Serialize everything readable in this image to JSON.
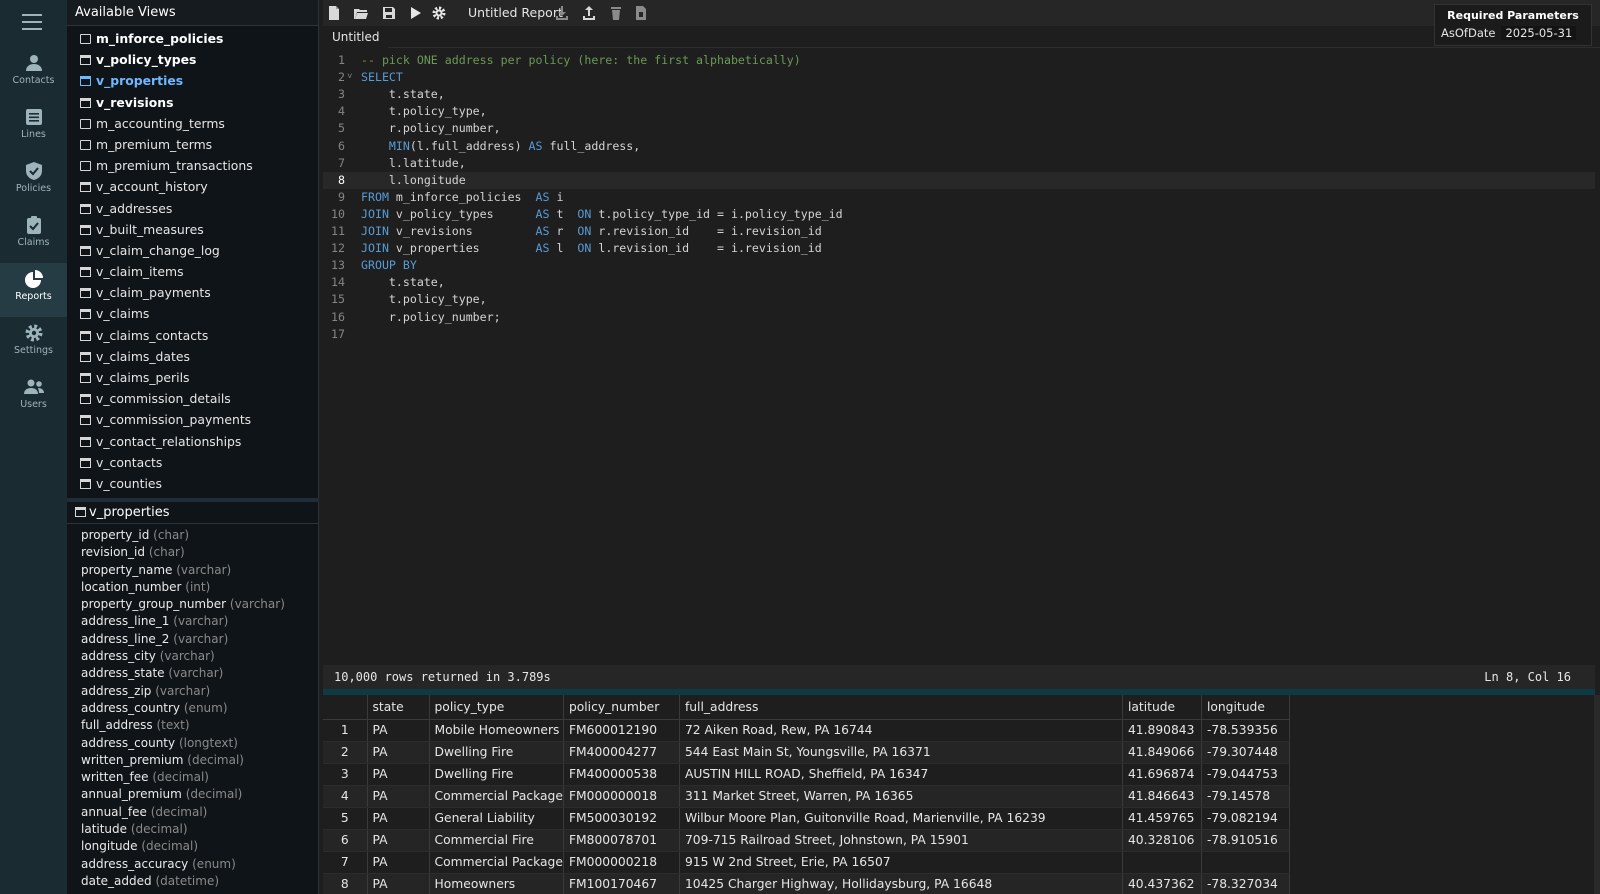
{
  "nav": {
    "items": [
      {
        "label": "Contacts",
        "icon": "person-icon"
      },
      {
        "label": "Lines",
        "icon": "list-icon"
      },
      {
        "label": "Policies",
        "icon": "shield-check-icon"
      },
      {
        "label": "Claims",
        "icon": "clipboard-check-icon"
      },
      {
        "label": "Reports",
        "icon": "pie-chart-icon",
        "active": true
      },
      {
        "label": "Settings",
        "icon": "gear-icon"
      },
      {
        "label": "Users",
        "icon": "users-icon"
      }
    ]
  },
  "views": {
    "title": "Available Views",
    "items": [
      {
        "label": "m_inforce_policies",
        "bold": true,
        "icon": "doc"
      },
      {
        "label": "v_policy_types",
        "bold": true,
        "icon": "table"
      },
      {
        "label": "v_properties",
        "bold": true,
        "selected": true,
        "icon": "table"
      },
      {
        "label": "v_revisions",
        "bold": true,
        "icon": "table"
      },
      {
        "label": "m_accounting_terms",
        "icon": "doc"
      },
      {
        "label": "m_premium_terms",
        "icon": "doc"
      },
      {
        "label": "m_premium_transactions",
        "icon": "doc"
      },
      {
        "label": "v_account_history",
        "icon": "table"
      },
      {
        "label": "v_addresses",
        "icon": "table"
      },
      {
        "label": "v_built_measures",
        "icon": "table"
      },
      {
        "label": "v_claim_change_log",
        "icon": "table"
      },
      {
        "label": "v_claim_items",
        "icon": "table"
      },
      {
        "label": "v_claim_payments",
        "icon": "table"
      },
      {
        "label": "v_claims",
        "icon": "table"
      },
      {
        "label": "v_claims_contacts",
        "icon": "table"
      },
      {
        "label": "v_claims_dates",
        "icon": "table"
      },
      {
        "label": "v_claims_perils",
        "icon": "table"
      },
      {
        "label": "v_commission_details",
        "icon": "table"
      },
      {
        "label": "v_commission_payments",
        "icon": "table"
      },
      {
        "label": "v_contact_relationships",
        "icon": "table"
      },
      {
        "label": "v_contacts",
        "icon": "table"
      },
      {
        "label": "v_counties",
        "icon": "table"
      }
    ]
  },
  "schema": {
    "title": "v_properties",
    "columns": [
      {
        "name": "property_id",
        "type": "(char)"
      },
      {
        "name": "revision_id",
        "type": "(char)"
      },
      {
        "name": "property_name",
        "type": "(varchar)"
      },
      {
        "name": "location_number",
        "type": "(int)"
      },
      {
        "name": "property_group_number",
        "type": "(varchar)"
      },
      {
        "name": "address_line_1",
        "type": "(varchar)"
      },
      {
        "name": "address_line_2",
        "type": "(varchar)"
      },
      {
        "name": "address_city",
        "type": "(varchar)"
      },
      {
        "name": "address_state",
        "type": "(varchar)"
      },
      {
        "name": "address_zip",
        "type": "(varchar)"
      },
      {
        "name": "address_country",
        "type": "(enum)"
      },
      {
        "name": "full_address",
        "type": "(text)"
      },
      {
        "name": "address_county",
        "type": "(longtext)"
      },
      {
        "name": "written_premium",
        "type": "(decimal)"
      },
      {
        "name": "written_fee",
        "type": "(decimal)"
      },
      {
        "name": "annual_premium",
        "type": "(decimal)"
      },
      {
        "name": "annual_fee",
        "type": "(decimal)"
      },
      {
        "name": "latitude",
        "type": "(decimal)"
      },
      {
        "name": "longitude",
        "type": "(decimal)"
      },
      {
        "name": "address_accuracy",
        "type": "(enum)"
      },
      {
        "name": "date_added",
        "type": "(datetime)"
      }
    ]
  },
  "toolbar": {
    "title": "Untitled Report"
  },
  "tab": {
    "label": "Untitled"
  },
  "params": {
    "heading": "Required Parameters",
    "name": "AsOfDate",
    "value": "2025-05-31"
  },
  "editor": {
    "current_line": 8,
    "lines": [
      [
        [
          "cm",
          "-- pick ONE address per policy (here: the first alphabetically)"
        ]
      ],
      [
        [
          "kw",
          "SELECT"
        ]
      ],
      [
        [
          "",
          "    t.state,"
        ]
      ],
      [
        [
          "",
          "    t.policy_type,"
        ]
      ],
      [
        [
          "",
          "    r.policy_number,"
        ]
      ],
      [
        [
          "",
          "    "
        ],
        [
          "kw",
          "MIN"
        ],
        [
          "",
          "(l.full_address) "
        ],
        [
          "kw",
          "AS"
        ],
        [
          "",
          " full_address,"
        ]
      ],
      [
        [
          "",
          "    l.latitude,"
        ]
      ],
      [
        [
          "",
          "    l.longitude"
        ]
      ],
      [
        [
          "kw",
          "FROM"
        ],
        [
          "",
          " m_inforce_policies  "
        ],
        [
          "kw",
          "AS"
        ],
        [
          "",
          " i"
        ]
      ],
      [
        [
          "kw",
          "JOIN"
        ],
        [
          "",
          " v_policy_types      "
        ],
        [
          "kw",
          "AS"
        ],
        [
          "",
          " t  "
        ],
        [
          "kw",
          "ON"
        ],
        [
          "",
          " t.policy_type_id = i.policy_type_id"
        ]
      ],
      [
        [
          "kw",
          "JOIN"
        ],
        [
          "",
          " v_revisions         "
        ],
        [
          "kw",
          "AS"
        ],
        [
          "",
          " r  "
        ],
        [
          "kw",
          "ON"
        ],
        [
          "",
          " r.revision_id    = i.revision_id"
        ]
      ],
      [
        [
          "kw",
          "JOIN"
        ],
        [
          "",
          " v_properties        "
        ],
        [
          "kw",
          "AS"
        ],
        [
          "",
          " l  "
        ],
        [
          "kw",
          "ON"
        ],
        [
          "",
          " l.revision_id    = i.revision_id"
        ]
      ],
      [
        [
          "kw",
          "GROUP BY"
        ]
      ],
      [
        [
          "",
          "    t.state,"
        ]
      ],
      [
        [
          "",
          "    t.policy_type,"
        ]
      ],
      [
        [
          "",
          "    r.policy_number;"
        ]
      ],
      [
        [
          "",
          ""
        ]
      ]
    ]
  },
  "status": {
    "rows_text": "10,000 rows returned in 3.789s",
    "cursor_text": "Ln 8, Col 16"
  },
  "results": {
    "headers": [
      "",
      "state",
      "policy_type",
      "policy_number",
      "full_address",
      "latitude",
      "longitude"
    ],
    "rows": [
      [
        "1",
        "PA",
        "Mobile Homeowners",
        "FM600012190",
        "72 Aiken Road, Rew, PA 16744",
        "41.890843",
        "-78.539356"
      ],
      [
        "2",
        "PA",
        "Dwelling Fire",
        "FM400004277",
        "544 East Main St, Youngsville, PA 16371",
        "41.849066",
        "-79.307448"
      ],
      [
        "3",
        "PA",
        "Dwelling Fire",
        "FM400000538",
        "AUSTIN HILL ROAD, Sheffield, PA 16347",
        "41.696874",
        "-79.044753"
      ],
      [
        "4",
        "PA",
        "Commercial Package",
        "FM000000018",
        "311 Market Street, Warren, PA 16365",
        "41.846643",
        "-79.14578"
      ],
      [
        "5",
        "PA",
        "General Liability",
        "FM500030192",
        "Wilbur Moore Plan, Guitonville Road, Marienville, PA 16239",
        "41.459765",
        "-79.082194"
      ],
      [
        "6",
        "PA",
        "Commercial Fire",
        "FM800078701",
        "709-715 Railroad Street, Johnstown, PA 15901",
        "40.328106",
        "-78.910516"
      ],
      [
        "7",
        "PA",
        "Commercial Package",
        "FM000000218",
        "915 W 2nd Street, Erie, PA 16507",
        "",
        ""
      ],
      [
        "8",
        "PA",
        "Homeowners",
        "FM100170467",
        "10425 Charger Highway, Hollidaysburg, PA 16648",
        "40.437362",
        "-78.327034"
      ]
    ]
  }
}
